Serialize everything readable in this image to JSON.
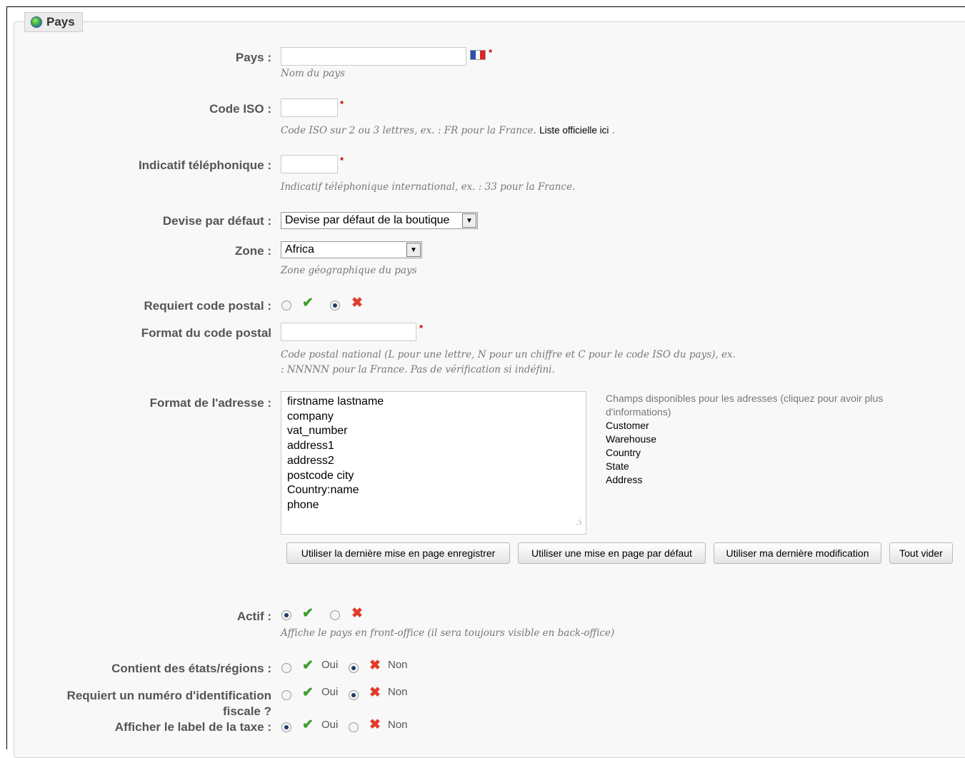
{
  "legend": {
    "title": "Pays"
  },
  "fields": {
    "pays": {
      "label": "Pays :",
      "value": "",
      "hint": "Nom du pays",
      "flag_colors": [
        "#2b4fae",
        "#ffffff",
        "#e0222c"
      ]
    },
    "iso": {
      "label": "Code ISO :",
      "value": "",
      "hint": "Code ISO sur 2 ou 3 lettres, ex. : FR pour la France.",
      "link_text": "Liste officielle ici",
      "hint_end": "."
    },
    "phone": {
      "label": "Indicatif téléphonique :",
      "value": "",
      "hint": "Indicatif téléphonique international, ex. : 33 pour la France."
    },
    "currency": {
      "label": "Devise par défaut :",
      "selected": "Devise par défaut de la boutique"
    },
    "zone": {
      "label": "Zone :",
      "selected": "Africa",
      "hint": "Zone géographique du pays"
    },
    "zip_required": {
      "label": "Requiert code postal :",
      "selected": "no"
    },
    "zip_format": {
      "label": "Format du code postal",
      "value": "",
      "hint_line1": "Code postal national (L pour une lettre, N pour un chiffre et C pour le code ISO du pays), ex.",
      "hint_line2": ": NNNNN pour la France. Pas de vérification si indéfini."
    },
    "address_format": {
      "label": "Format de l'adresse :",
      "lines": [
        "firstname lastname",
        "company",
        "vat_number",
        "address1",
        "address2",
        "postcode city",
        "Country:name",
        "phone"
      ],
      "available_title": "Champs disponibles pour les adresses (cliquez pour avoir plus d'informations)",
      "available": [
        "Customer",
        "Warehouse",
        "Country",
        "State",
        "Address"
      ]
    },
    "active": {
      "label": "Actif :",
      "selected": "yes",
      "hint": "Affiche le pays en front-office (il sera toujours visible en back-office)"
    },
    "states": {
      "label": "Contient des états/régions :",
      "selected": "no"
    },
    "vat_number": {
      "label_line1": "Requiert un numéro d'identification",
      "label_line2": "fiscale ?",
      "selected": "no"
    },
    "tax_label": {
      "label": "Afficher le label de la taxe :",
      "selected": "yes"
    }
  },
  "yes_label": "Oui",
  "no_label": "Non",
  "buttons": {
    "last_saved": "Utiliser la dernière mise en page enregistrer",
    "default_layout": "Utiliser une mise en page par défaut",
    "last_modif": "Utiliser ma dernière modification",
    "clear": "Tout vider"
  }
}
